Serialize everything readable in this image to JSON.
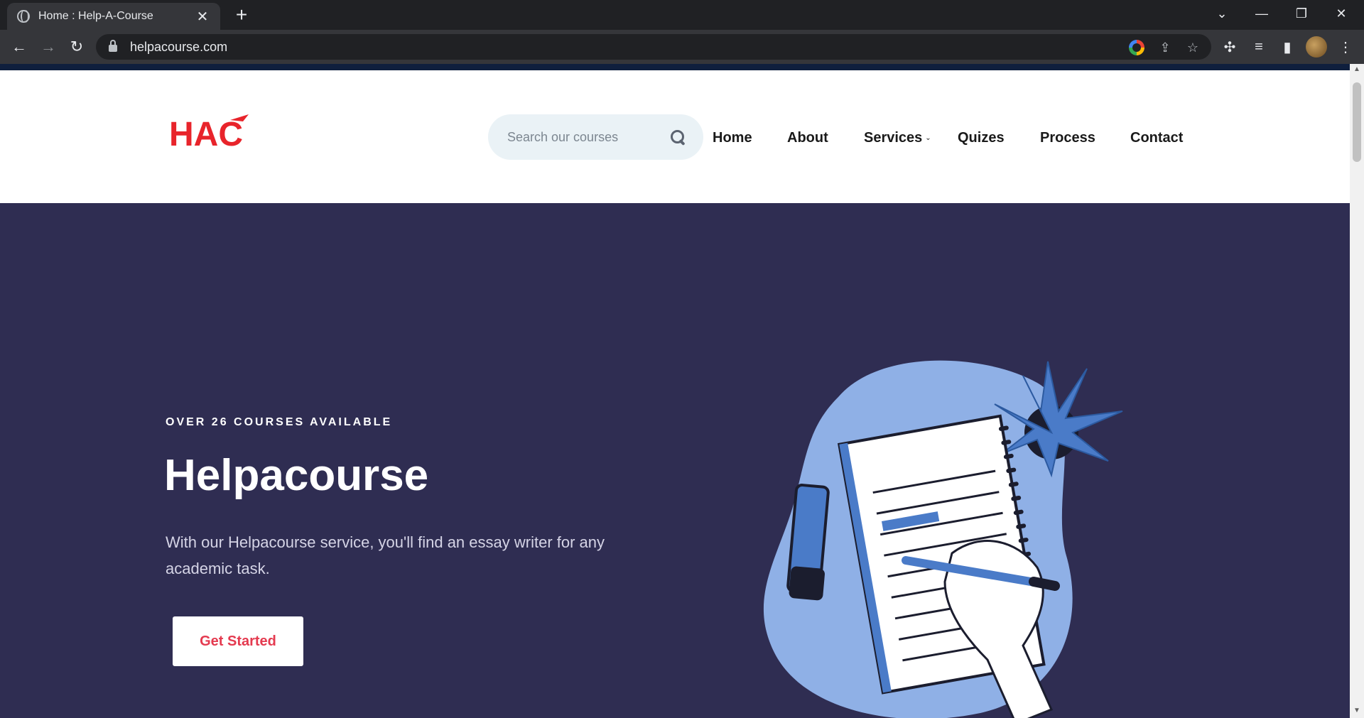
{
  "browser": {
    "tab_title": "Home : Help-A-Course",
    "url": "helpacourse.com"
  },
  "site": {
    "logo_text": "HAC",
    "search": {
      "placeholder": "Search our courses"
    },
    "nav": [
      {
        "label": "Home"
      },
      {
        "label": "About"
      },
      {
        "label": "Services"
      },
      {
        "label": "Quizes"
      },
      {
        "label": "Process"
      },
      {
        "label": "Contact"
      }
    ]
  },
  "hero": {
    "eyebrow": "OVER 26 COURSES AVAILABLE",
    "title": "Helpacourse",
    "text": "With our Helpacourse service, you'll find an essay writer for any academic task.",
    "cta_label": "Get Started"
  },
  "colors": {
    "hero_bg": "#2f2d52",
    "brand_red": "#e43a4f",
    "illustration_blue": "#4a7bc8",
    "blob": "#8fb0e6"
  }
}
